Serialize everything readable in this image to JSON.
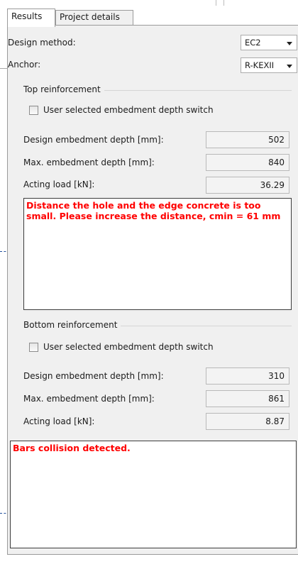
{
  "tabs": {
    "results": "Results",
    "project_details": "Project details"
  },
  "design_method": {
    "label": "Design method:",
    "value": "EC2"
  },
  "anchor": {
    "label": "Anchor:",
    "value": "R-KEXII"
  },
  "top": {
    "group_title": "Top reinforcement",
    "checkbox_label": "User selected embedment depth switch",
    "checkbox_checked": false,
    "design_depth_label": "Design embedment depth [mm]:",
    "design_depth_value": "502",
    "max_depth_label": "Max. embedment depth [mm]:",
    "max_depth_value": "840",
    "load_label": "Acting load [kN]:",
    "load_value": "36.29",
    "message": "Distance the hole and the edge concrete is too small. Please increase the distance, cmin = 61 mm"
  },
  "bottom": {
    "group_title": "Bottom reinforcement",
    "checkbox_label": "User selected embedment depth switch",
    "checkbox_checked": false,
    "design_depth_label": "Design embedment depth [mm]:",
    "design_depth_value": "310",
    "max_depth_label": "Max. embedment depth [mm]:",
    "max_depth_value": "861",
    "load_label": "Acting load [kN]:",
    "load_value": "8.87",
    "message": "Bars collision detected."
  },
  "colors": {
    "error_text": "#ff0000",
    "panel_bg": "#f0f0f0",
    "leader_line": "#1f4e9a"
  }
}
